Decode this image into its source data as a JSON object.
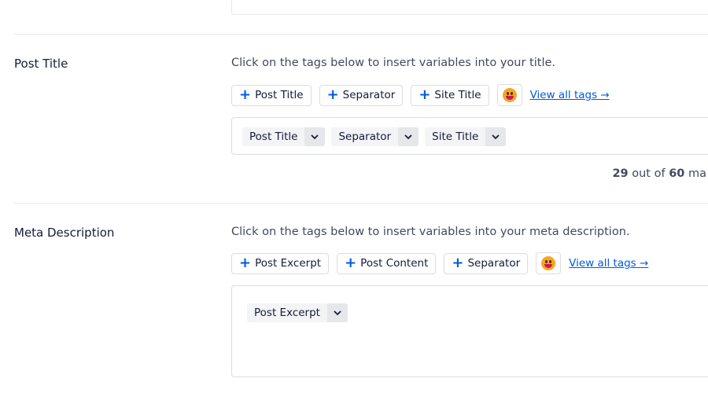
{
  "post_title": {
    "label": "Post Title",
    "hint": "Click on the tags below to insert variables into your title.",
    "tag_buttons": [
      "Post Title",
      "Separator",
      "Site Title"
    ],
    "view_all": "View all tags →",
    "pills": [
      "Post Title",
      "Separator",
      "Site Title"
    ],
    "count": {
      "current": "29",
      "text": "out of",
      "max": "60",
      "suffix": "ma"
    }
  },
  "meta_description": {
    "label": "Meta Description",
    "hint": "Click on the tags below to insert variables into your meta description.",
    "tag_buttons": [
      "Post Excerpt",
      "Post Content",
      "Separator"
    ],
    "view_all": "View all tags →",
    "pills": [
      "Post Excerpt"
    ]
  },
  "colors": {
    "accent": "#005ae0",
    "text": "#141b38"
  },
  "icons": {
    "add": "plus-icon",
    "emoji": "emoji-icon",
    "dropdown": "chevron-down-icon"
  }
}
